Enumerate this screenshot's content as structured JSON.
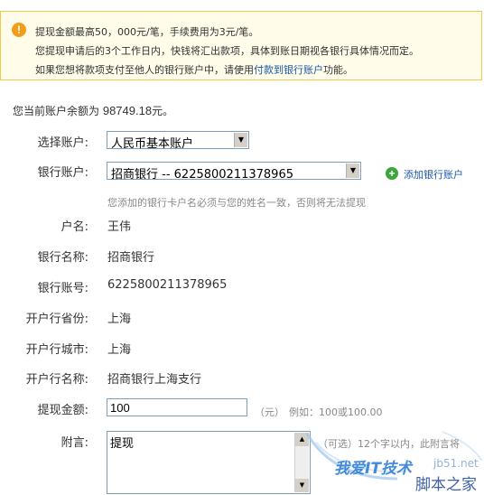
{
  "notice": {
    "icon": "warning-icon",
    "line1": "提现金额最高50，000元/笔，手续费用为3元/笔。",
    "line2": "您提现申请后的3个工作日内，快钱将汇出款项，具体到账日期视各银行具体情况而定。",
    "line3_prefix": "如果您想将款项支付至他人的银行账户中，请使用",
    "line3_link": "付款到银行账户",
    "line3_suffix": "功能。"
  },
  "balance": {
    "prefix": "您当前账户余额为",
    "amount": "98749.18",
    "suffix": "元。"
  },
  "form": {
    "select_account_label": "选择账户:",
    "select_account_value": "人民币基本账户",
    "bank_account_label": "银行账户:",
    "bank_account_value": "招商银行  -- 6225800211378965",
    "add_bank_label": "添加银行账户",
    "hint": "您添加的银行卡户名必须与您的姓名一致，否则将无法提现",
    "holder_label": "户名:",
    "holder_value": "王伟",
    "bank_name_label": "银行名称:",
    "bank_name_value": "招商银行",
    "bank_number_label": "银行账号:",
    "bank_number_value": "6225800211378965",
    "province_label": "开户行省份:",
    "province_value": "上海",
    "city_label": "开户行城市:",
    "city_value": "上海",
    "branch_label": "开户行名称:",
    "branch_value": "招商银行上海支行",
    "amount_label": "提现金额:",
    "amount_value": "100",
    "amount_unit": "（元）",
    "amount_example": "例如：100或100.00",
    "note_label": "附言:",
    "note_value": "提现",
    "note_hint": "（可选）12个字以内，此附言将"
  },
  "watermark": {
    "text1": "我爱IT技术",
    "text2": "jb51.net",
    "text3": "脚本之家"
  },
  "colors": {
    "notice_bg": "#fffcea",
    "notice_border": "#f2c94c",
    "link": "#1a58a8",
    "add_icon": "#3ca63c"
  }
}
